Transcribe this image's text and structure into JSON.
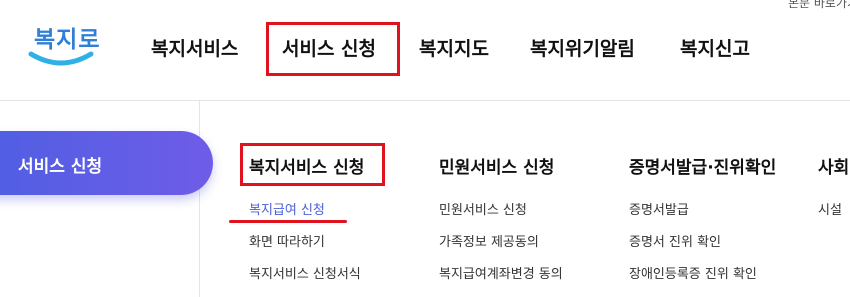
{
  "header": {
    "top_link": "본문 바로가기",
    "logo_text": "복지로",
    "gnb": [
      "복지서비스",
      "서비스 신청",
      "복지지도",
      "복지위기알림",
      "복지신고"
    ]
  },
  "sidebar": {
    "active_label": "서비스 신청"
  },
  "columns": [
    {
      "title": "복지서비스 신청",
      "items": [
        "복지급여 신청",
        "화면 따라하기",
        "복지서비스 신청서식"
      ]
    },
    {
      "title": "민원서비스 신청",
      "items": [
        "민원서비스 신청",
        "가족정보 제공동의",
        "복지급여계좌변경 동의"
      ]
    },
    {
      "title": "증명서발급·진위확인",
      "items": [
        "증명서발급",
        "증명서 진위 확인",
        "장애인등록증 진위 확인"
      ]
    },
    {
      "title": "사회",
      "items": [
        "시설"
      ]
    }
  ],
  "colors": {
    "accent": "#4b5fd9",
    "highlight_red": "#e0121e",
    "logo_blue": "#2f7fd8"
  }
}
